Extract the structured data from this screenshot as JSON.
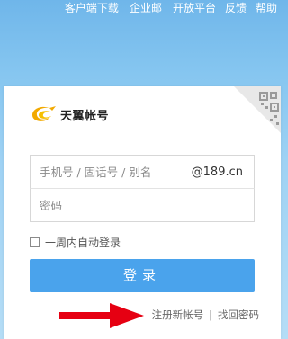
{
  "top_nav": {
    "items": [
      "客户端下载",
      "企业邮",
      "开放平台",
      "反馈",
      "帮助"
    ]
  },
  "logo": {
    "text": "天翼帐号",
    "brand_color": "#f2a900"
  },
  "login": {
    "username_placeholder": "手机号 / 固话号 / 别名",
    "username_suffix": "@189.cn",
    "password_placeholder": "密码",
    "remember_label": "一周内自动登录",
    "submit_label": "登录"
  },
  "links": {
    "register": "注册新帐号",
    "separator": "|",
    "forgot": "找回密码"
  },
  "colors": {
    "button": "#4aa3ec",
    "arrow": "#e60012",
    "background_top": "#6fb6ea"
  },
  "icons": {
    "qr": "qr-code-icon",
    "arrow": "red-arrow-icon"
  }
}
